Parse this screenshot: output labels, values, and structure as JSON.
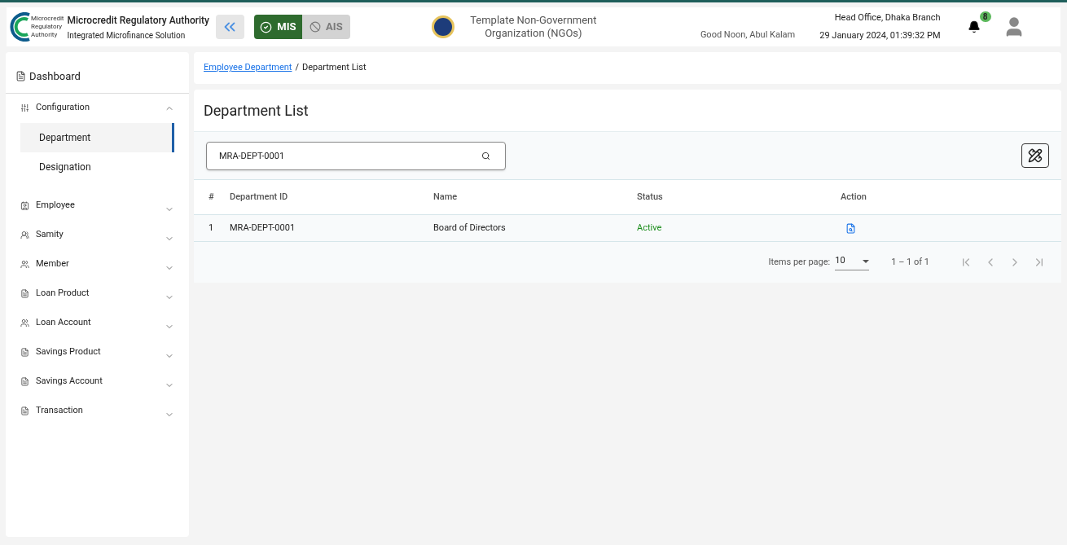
{
  "header": {
    "logo_text": [
      "Microcredit",
      "Regulatory",
      "Authority"
    ],
    "title": "Microcredit Regulatory Authority",
    "subtitle": "Integrated Microfinance Solution",
    "modules": [
      {
        "label": "MIS",
        "selected": true
      },
      {
        "label": "AIS",
        "selected": false
      }
    ],
    "org_name": "Template Non-Government Organization (NGOs)",
    "greeting": "Good Noon, Abul Kalam",
    "branch": "Head Office, Dhaka Branch",
    "datetime": "29 January 2024, 01:39:32 PM",
    "notification_count": "8"
  },
  "sidebar": {
    "dashboard": "Dashboard",
    "groups": [
      {
        "label": "Configuration",
        "kind": "sliders",
        "expanded": true,
        "children": [
          {
            "label": "Department",
            "selected": true
          },
          {
            "label": "Designation",
            "selected": false
          }
        ]
      },
      {
        "label": "Employee",
        "kind": "badge",
        "expanded": false
      },
      {
        "label": "Samity",
        "kind": "group",
        "expanded": false
      },
      {
        "label": "Member",
        "kind": "people",
        "expanded": false
      },
      {
        "label": "Loan Product",
        "kind": "doc",
        "expanded": false
      },
      {
        "label": "Loan Account",
        "kind": "people",
        "expanded": false
      },
      {
        "label": "Savings Product",
        "kind": "doc",
        "expanded": false
      },
      {
        "label": "Savings Account",
        "kind": "doc",
        "expanded": false
      },
      {
        "label": "Transaction",
        "kind": "doc",
        "expanded": false
      }
    ]
  },
  "breadcrumb_separator": "/",
  "breadcrumb": [
    {
      "label": "Employee Department",
      "kind": "link"
    },
    {
      "label": "Department List",
      "kind": "current"
    }
  ],
  "page_title": "Department List",
  "search": {
    "value": "MRA-DEPT-0001"
  },
  "table": {
    "columns": [
      "#",
      "Department ID",
      "Name",
      "Status",
      "Action"
    ],
    "rows": [
      {
        "index": "1",
        "department_id": "MRA-DEPT-0001",
        "name": "Board of Directors",
        "status": "Active"
      }
    ]
  },
  "pagination": {
    "label": "Items per page:",
    "page_size": "10",
    "range": "1 – 1 of 1"
  }
}
